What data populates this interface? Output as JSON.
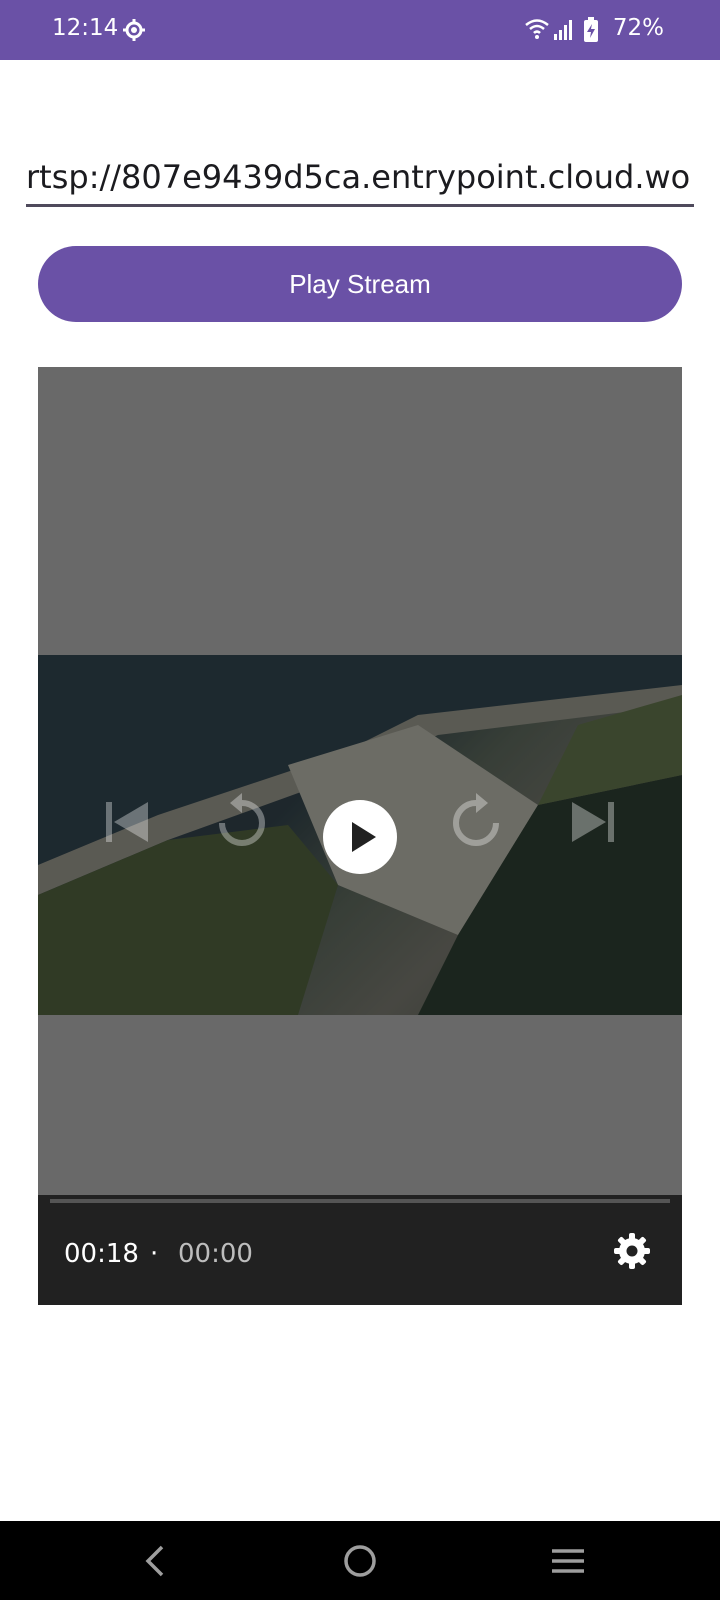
{
  "status_bar": {
    "time": "12:14",
    "battery": "72%"
  },
  "url_input": {
    "value": "rtsp://807e9439d5ca.entrypoint.cloud.wo"
  },
  "play_stream_button": {
    "label": "Play Stream"
  },
  "player": {
    "current_time": "00:18",
    "separator": "·",
    "duration": "00:00"
  },
  "colors": {
    "accent": "#6a51a6",
    "player_bg": "#696969",
    "controls_bar": "#212121"
  }
}
